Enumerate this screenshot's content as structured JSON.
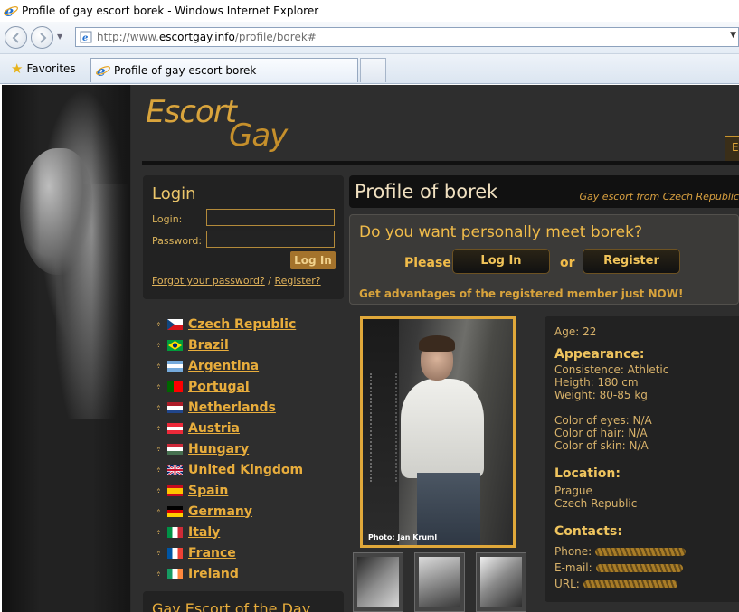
{
  "window": {
    "title": "Profile of gay escort borek - Windows Internet Explorer"
  },
  "address": {
    "url_prefix": "http://www.",
    "url_domain": "escortgay.info",
    "url_path": "/profile/borek#"
  },
  "favorites": {
    "label": "Favorites"
  },
  "tab": {
    "title": "Profile of gay escort borek"
  },
  "site": {
    "logo_word1": "Escort",
    "logo_word2": "Gay",
    "top_tab_letter": "E"
  },
  "login": {
    "title": "Login",
    "login_label": "Login:",
    "password_label": "Password:",
    "login_value": "",
    "password_value": "",
    "button": "Log In",
    "forgot": "Forgot your password?",
    "separator": " / ",
    "register": "Register?"
  },
  "countries": [
    {
      "name": "Czech Republic",
      "flag": "cz"
    },
    {
      "name": "Brazil",
      "flag": "br"
    },
    {
      "name": "Argentina",
      "flag": "ar"
    },
    {
      "name": "Portugal",
      "flag": "pt"
    },
    {
      "name": "Netherlands",
      "flag": "nl"
    },
    {
      "name": "Austria",
      "flag": "at"
    },
    {
      "name": "Hungary",
      "flag": "hu"
    },
    {
      "name": "United Kingdom",
      "flag": "gb"
    },
    {
      "name": "Spain",
      "flag": "es"
    },
    {
      "name": "Germany",
      "flag": "de"
    },
    {
      "name": "Italy",
      "flag": "it"
    },
    {
      "name": "France",
      "flag": "fr"
    },
    {
      "name": "Ireland",
      "flag": "ie"
    }
  ],
  "escort_of_day": {
    "title": "Gay Escort of the Day"
  },
  "profile": {
    "title": "Profile of borek",
    "subtitle": "Gay escort from Czech Republic",
    "meet_title": "Do you want personally meet borek?",
    "please": "Please",
    "login_btn": "Log In",
    "or": "or",
    "register_btn": "Register",
    "note": "Get advantages of the registered member just NOW!",
    "photo_credit": "Photo: Jan Kruml",
    "age": "Age: 22",
    "appearance_head": "Appearance:",
    "consistence": "Consistence: Athletic",
    "height": "Heigth: 180 cm",
    "weight": "Weight: 80-85 kg",
    "eyes": "Color of eyes: N/A",
    "hair": "Color of hair: N/A",
    "skin": "Color of skin: N/A",
    "location_head": "Location:",
    "city": "Prague",
    "country": "Czech Republic",
    "contacts_head": "Contacts:",
    "phone_label": "Phone:",
    "email_label": "E-mail:",
    "url_label": "URL:"
  },
  "colors": {
    "accent": "#e8ad3c",
    "background": "#2e2e2e",
    "panel": "#222222"
  }
}
